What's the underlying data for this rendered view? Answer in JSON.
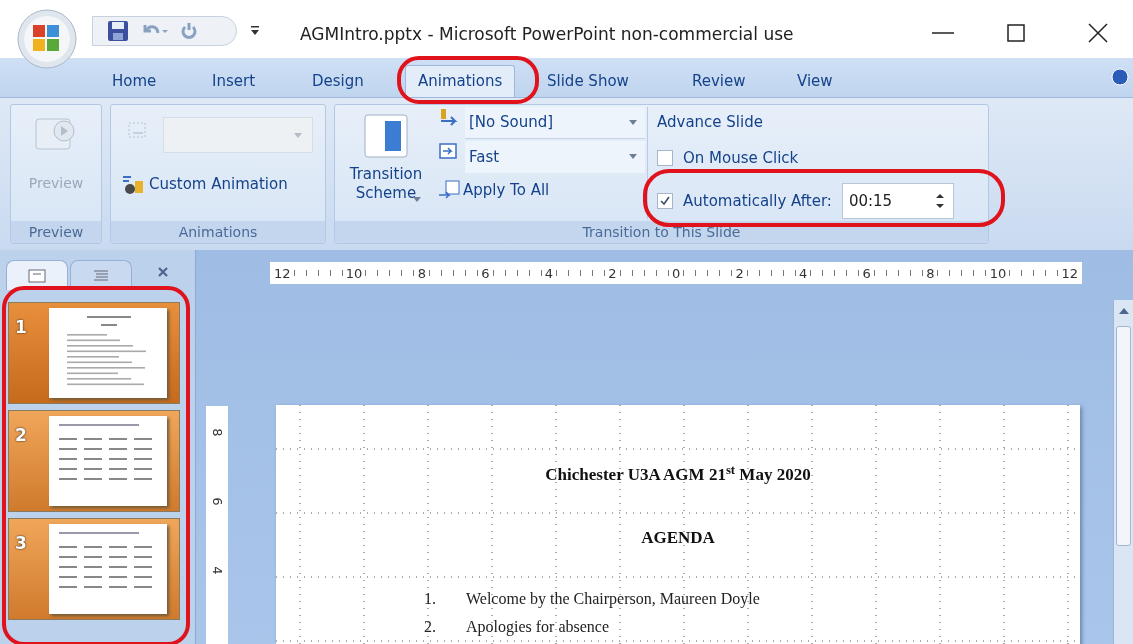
{
  "window": {
    "title": "AGMIntro.pptx - Microsoft PowerPoint non-commercial use"
  },
  "tabs": [
    {
      "label": "Home",
      "selected": false,
      "highlighted": false
    },
    {
      "label": "Insert",
      "selected": false,
      "highlighted": false
    },
    {
      "label": "Design",
      "selected": false,
      "highlighted": false
    },
    {
      "label": "Animations",
      "selected": true,
      "highlighted": true
    },
    {
      "label": "Slide Show",
      "selected": false,
      "highlighted": false
    },
    {
      "label": "Review",
      "selected": false,
      "highlighted": false
    },
    {
      "label": "View",
      "selected": false,
      "highlighted": false
    }
  ],
  "ribbon": {
    "groups": [
      {
        "kind": "preview",
        "label": "Preview",
        "button": {
          "label": "Preview",
          "disabled": true
        }
      },
      {
        "kind": "animations",
        "label": "Animations",
        "animate_dropdown": {
          "disabled": true
        },
        "custom_animation": "Custom Animation"
      },
      {
        "kind": "transition",
        "label": "Transition to This Slide",
        "scheme_button": "Transition Scheme",
        "sound": "[No Sound]",
        "speed": "Fast",
        "apply": "Apply To All",
        "advance_title": "Advance Slide",
        "on_mouse_click": {
          "label": "On Mouse Click",
          "checked": false
        },
        "automatically_after": {
          "label": "Automatically After:",
          "checked": true,
          "value": "00:15",
          "highlighted": true
        }
      }
    ]
  },
  "slides_panel": {
    "highlighted": true,
    "views": [
      {
        "kind": "slides",
        "selected": true
      },
      {
        "kind": "outline",
        "selected": false
      }
    ],
    "slides": [
      {
        "number": "1",
        "kind": "agenda",
        "selected": true
      },
      {
        "number": "2",
        "kind": "table",
        "selected": false
      },
      {
        "number": "3",
        "kind": "table",
        "selected": false
      }
    ]
  },
  "ruler": {
    "horizontal": [
      "12",
      "10",
      "8",
      "6",
      "4",
      "2",
      "0",
      "2",
      "4",
      "6",
      "8",
      "10",
      "12"
    ],
    "vertical": [
      "8",
      "6",
      "4"
    ]
  },
  "slide": {
    "title": "Chichester U3A AGM 21$^{st}$ May 2020",
    "heading": "AGENDA",
    "items": [
      {
        "number": "1.",
        "text": "Welcome by the Chairperson, Maureen Doyle"
      },
      {
        "number": "2.",
        "text": "Apologies for absence"
      }
    ]
  }
}
